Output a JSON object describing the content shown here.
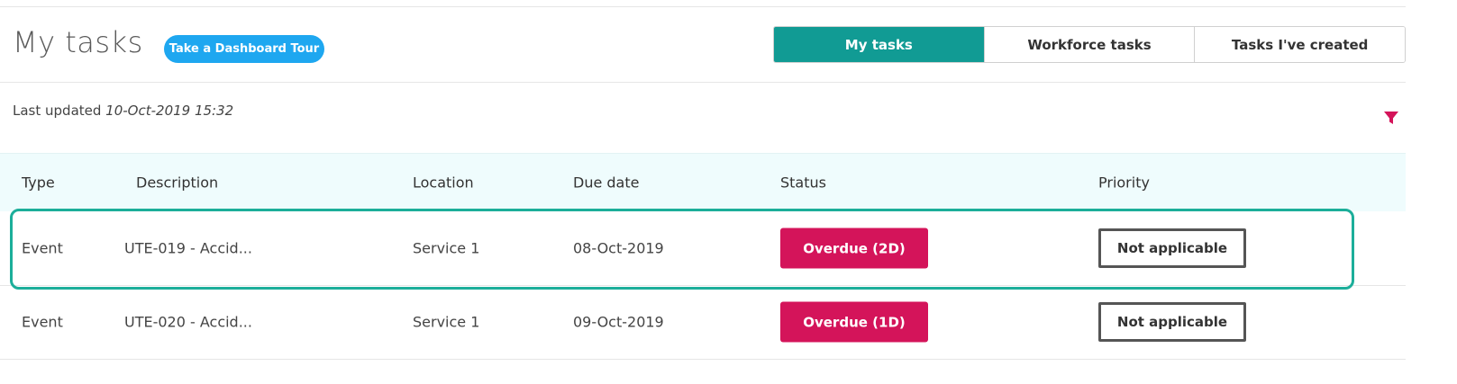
{
  "header": {
    "title": "My tasks",
    "tour_button": "Take a Dashboard Tour"
  },
  "tabs": [
    {
      "label": "My tasks",
      "active": true
    },
    {
      "label": "Workforce tasks",
      "active": false
    },
    {
      "label": "Tasks I've created",
      "active": false
    }
  ],
  "last_updated": {
    "label": "Last updated",
    "timestamp": "10-Oct-2019 15:32"
  },
  "filter": {
    "icon": "filter-icon",
    "color": "#d4145a"
  },
  "table": {
    "columns": [
      "Type",
      "Description",
      "Location",
      "Due date",
      "Status",
      "Priority"
    ],
    "rows": [
      {
        "type": "Event",
        "description": "UTE-019 - Accid...",
        "location": "Service 1",
        "due_date": "08-Oct-2019",
        "status": "Overdue (2D)",
        "priority": "Not applicable",
        "highlighted": true
      },
      {
        "type": "Event",
        "description": "UTE-020 - Accid...",
        "location": "Service 1",
        "due_date": "09-Oct-2019",
        "status": "Overdue (1D)",
        "priority": "Not applicable",
        "highlighted": false
      }
    ]
  },
  "colors": {
    "accent_teal": "#119b94",
    "tour_blue": "#1ea7f0",
    "overdue": "#d4145a",
    "highlight": "#1cae9a",
    "header_bg": "#effcfd"
  }
}
